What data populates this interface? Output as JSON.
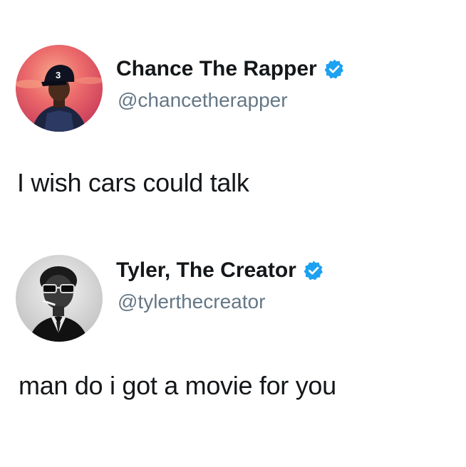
{
  "tweets": [
    {
      "display_name": "Chance The Rapper",
      "handle": "@chancetherapper",
      "verified": true,
      "avatar_icon": "chance-the-rapper-avatar",
      "cap_number": "3",
      "text": "I wish cars could talk"
    },
    {
      "display_name": "Tyler, The Creator",
      "handle": "@tylerthecreator",
      "verified": true,
      "avatar_icon": "tyler-the-creator-avatar",
      "text": "man do i got a movie for you"
    }
  ],
  "colors": {
    "name": "#14171a",
    "handle": "#657786",
    "verified_badge": "#1da1f2",
    "background": "#ffffff"
  }
}
